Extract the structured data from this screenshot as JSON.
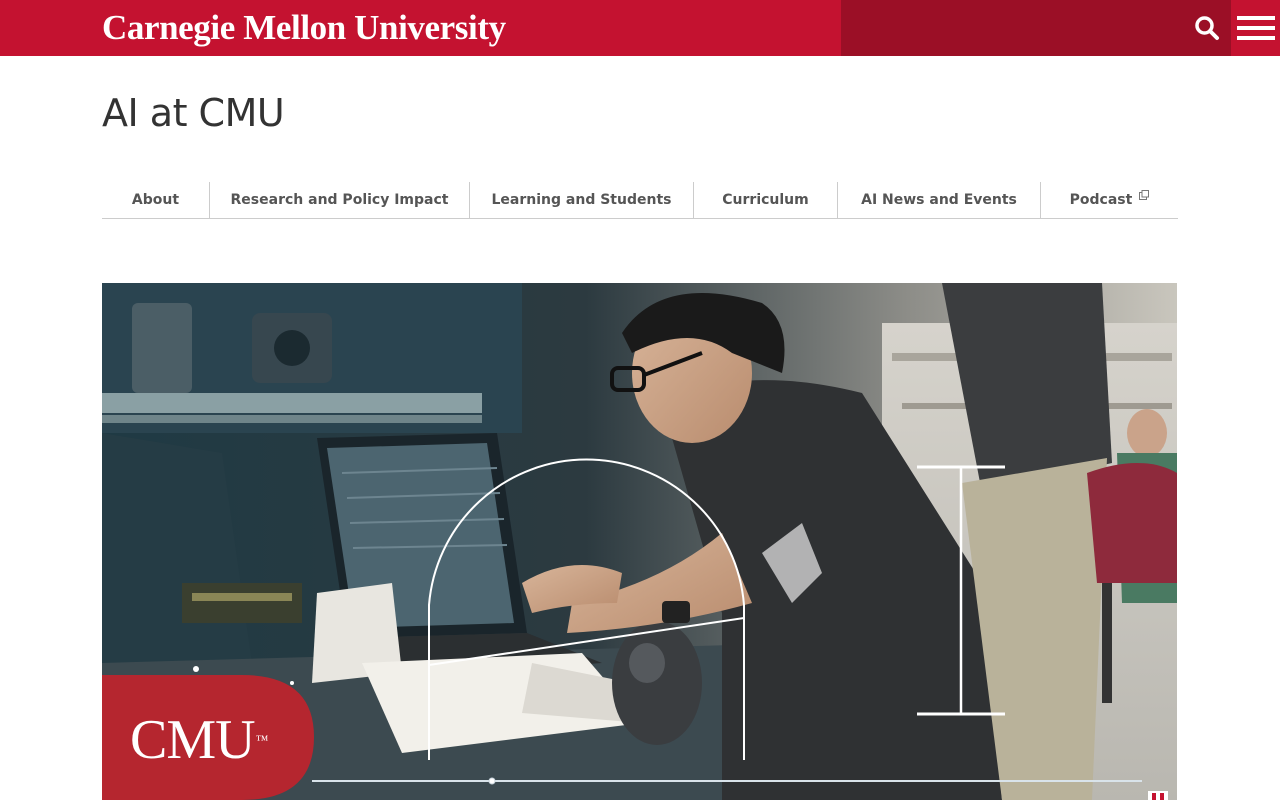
{
  "header": {
    "wordmark": "Carnegie Mellon University",
    "search_icon": "search-icon",
    "menu_icon": "hamburger-menu-icon",
    "colors": {
      "brand_red": "#c41230",
      "dark_red": "#9b0f26"
    }
  },
  "site": {
    "title": "AI at CMU"
  },
  "nav": {
    "items": [
      {
        "label": "About"
      },
      {
        "label": "Research and Policy Impact"
      },
      {
        "label": "Learning and Students"
      },
      {
        "label": "Curriculum"
      },
      {
        "label": "AI News and Events"
      },
      {
        "label": "Podcast",
        "icon": "external-link-icon"
      }
    ]
  },
  "hero": {
    "badge_text": "CMU",
    "badge_mark": "™"
  }
}
